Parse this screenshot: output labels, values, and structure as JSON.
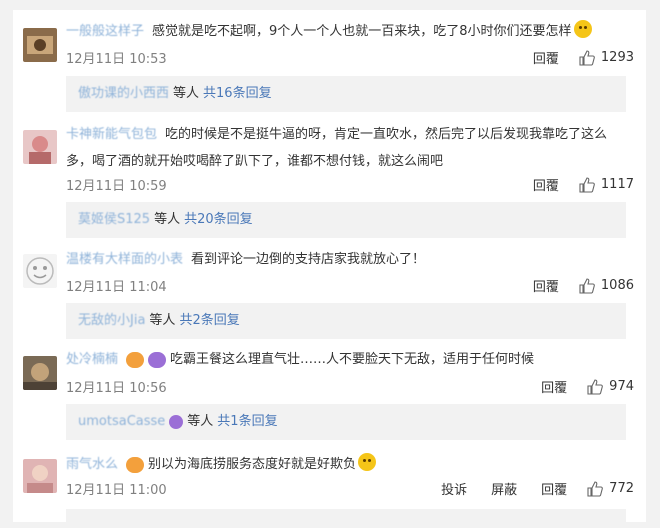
{
  "comments": [
    {
      "user": "一般般这样子",
      "text": "感觉就是吃不起啊，9个人一个人也就一百来块，吃了8小时你们还要怎样",
      "time": "12月11日 10:53",
      "reply_label": "回覆",
      "likes": "1293",
      "replies": {
        "name": "傲功课的小西西",
        "mid": "等人",
        "link": "共16条回复"
      }
    },
    {
      "user": "卡神新能气包包",
      "text": "吃的时候是不是挺牛逼的呀，肯定一直吹水，然后完了以后发现我靠吃了这么多，喝了酒的就开始哎喝醉了趴下了，谁都不想付钱，就这么闹吧",
      "time": "12月11日 10:59",
      "reply_label": "回覆",
      "likes": "1117",
      "replies": {
        "name": "莫姬侯S125",
        "mid": "等人",
        "link": "共20条回复"
      }
    },
    {
      "user": "温楼有大样面的小表",
      "text": "看到评论一边倒的支持店家我就放心了！",
      "time": "12月11日 11:04",
      "reply_label": "回覆",
      "likes": "1086",
      "replies": {
        "name": "无敌的小Jia",
        "mid": "等人",
        "link": "共2条回复"
      }
    },
    {
      "user": "处冷楠楠",
      "text": "吃霸王餐这么理直气壮……人不要脸天下无敌，适用于任何时候",
      "time": "12月11日 10:56",
      "reply_label": "回覆",
      "likes": "974",
      "replies": {
        "name": "umotsaCasse",
        "mid": "等人",
        "link": "共1条回复"
      }
    },
    {
      "user": "雨气水么",
      "text": "别以为海底捞服务态度好就是好欺负",
      "time": "12月11日 11:00",
      "report_label": "投诉",
      "block_label": "屏蔽",
      "reply_label": "回覆",
      "likes": "772"
    }
  ],
  "colors": {
    "link": "#4a78b8",
    "username": "#8fb3d9",
    "reply_bg": "#f2f2f2"
  },
  "icons": [
    "thumbs-up-icon",
    "smile-emoji-icon",
    "purple-bird-badge-icon"
  ]
}
